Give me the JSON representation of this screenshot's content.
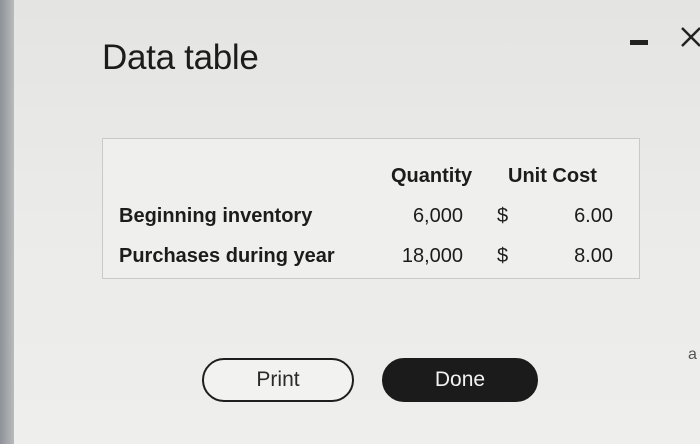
{
  "dialog": {
    "title": "Data table",
    "minimize_icon": "minimize-icon",
    "close_icon": "close-icon",
    "close_glyph": "✕"
  },
  "table": {
    "headers": {
      "quantity": "Quantity",
      "unit_cost": "Unit Cost"
    },
    "rows": [
      {
        "label": "Beginning inventory",
        "quantity": "6,000",
        "currency": "$",
        "unit_cost": "6.00"
      },
      {
        "label": "Purchases during year",
        "quantity": "18,000",
        "currency": "$",
        "unit_cost": "8.00"
      }
    ]
  },
  "buttons": {
    "print_label": "Print",
    "done_label": "Done"
  },
  "edge_text": "a"
}
